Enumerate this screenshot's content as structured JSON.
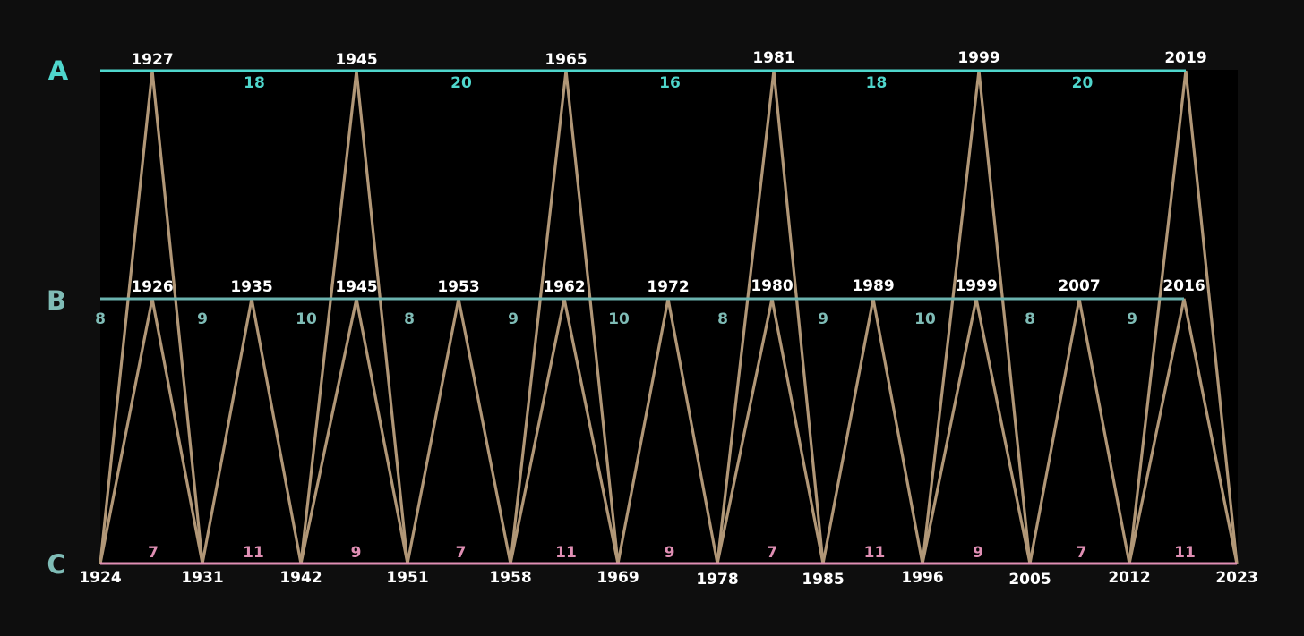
{
  "colors": {
    "background": "#0e0e0e",
    "plot_background": "#000000",
    "line_a": "#4fd6cc",
    "line_b": "#6ab2ae",
    "line_c": "#e08fb4",
    "zigzag": "#b19777",
    "year_text": "#ffffff",
    "label_a": "#4fd6cc",
    "label_b": "#7fbcb6",
    "label_c": "#7fbcb6"
  },
  "rows": [
    {
      "id": "A",
      "label": "A",
      "years": [
        1927,
        1945,
        1965,
        1981,
        1999,
        2019
      ],
      "intervals": [
        18,
        20,
        16,
        18,
        20
      ]
    },
    {
      "id": "B",
      "label": "B",
      "years": [
        1926,
        1935,
        1945,
        1953,
        1962,
        1972,
        1980,
        1989,
        1999,
        2007,
        2016
      ],
      "intervals_left": [
        8,
        9,
        10,
        8,
        9,
        10,
        8,
        9,
        10,
        8,
        9
      ]
    },
    {
      "id": "C",
      "label": "C",
      "years": [
        1924,
        1931,
        1942,
        1951,
        1958,
        1969,
        1978,
        1985,
        1996,
        2005,
        2012,
        2023
      ],
      "intervals": [
        7,
        11,
        9,
        7,
        11,
        9,
        7,
        11,
        9,
        7,
        11
      ]
    }
  ]
}
